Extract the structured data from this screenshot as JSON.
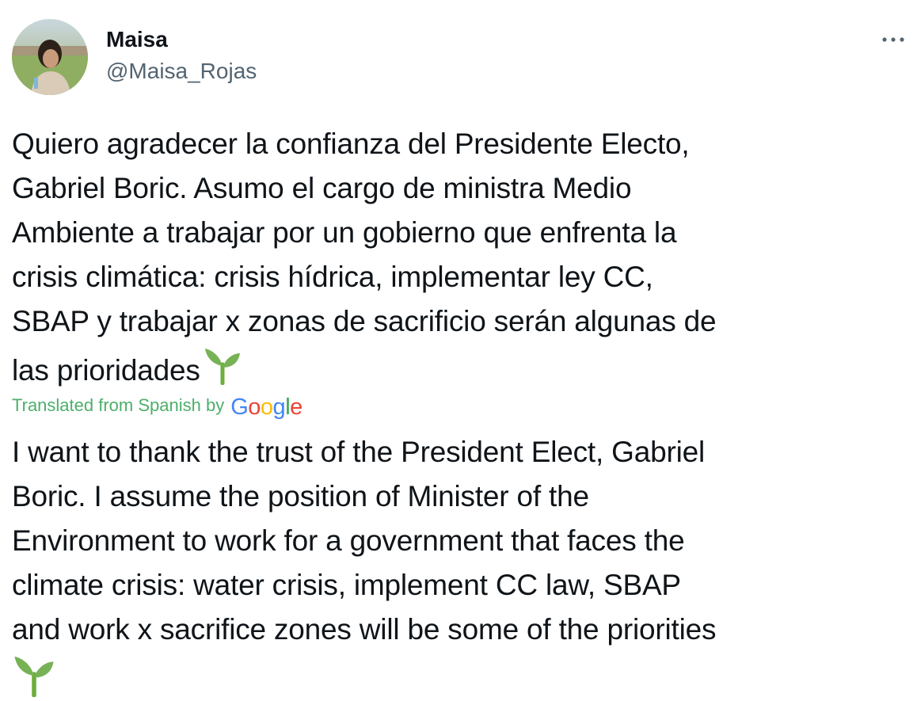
{
  "author": {
    "name": "Maisa",
    "handle": "@Maisa_Rojas",
    "avatar_icon": "avatar-photo"
  },
  "more_icon": "more-options-icon",
  "tweet": {
    "original_lines": [
      "Quiero agradecer la confianza del Presidente Electo,",
      "Gabriel Boric. Asumo el cargo de ministra Medio",
      "Ambiente a trabajar por un gobierno que enfrenta la",
      "crisis climática: crisis hídrica, implementar ley CC,",
      "SBAP y trabajar x zonas de sacrificio serán algunas de",
      "las prioridades"
    ],
    "translation_label": "Translated from Spanish by",
    "translation_provider": "Google",
    "translated_lines": [
      "I want to thank the trust of the President Elect, Gabriel",
      "Boric. I assume the position of Minister of the",
      "Environment to work for a government that faces the",
      "climate crisis: water crisis, implement CC law, SBAP",
      "and work x sacrifice zones will be some of the priorities"
    ],
    "emoji": "seedling-emoji"
  },
  "colors": {
    "text": "#0f1419",
    "secondary": "#536471",
    "translation_green": "#4caf6a"
  }
}
